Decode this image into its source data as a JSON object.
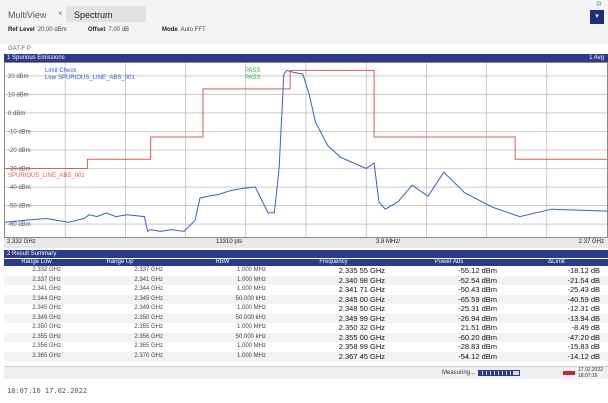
{
  "header": {
    "tab_multiview": "MultiView",
    "tab_close": "×",
    "tab_spectrum": "Spectrum",
    "ref_level_label": "Ref Level",
    "ref_level_value": "20.00 dBm",
    "offset_label": "Offset",
    "offset_value": "7.00 dB",
    "mode_label": "Mode",
    "mode_value": "Auto FFT",
    "sub_label": "GAT-F P"
  },
  "chart_panel": {
    "title": "1 Spurious Emissions",
    "badge": "1 Avg",
    "legend_line1": "Limit Check",
    "legend_line2": "Line     SPURIOUS_LINE_ABS_001",
    "legend_pass1": "PASS",
    "legend_pass2": "PASS",
    "limit_line_label": "SPURIOUS_LINE_ABS_001",
    "start_freq": "2.332 GHz",
    "points": "13310 pts",
    "step": "3.8 MHz/",
    "stop_freq": "2.37 GHz"
  },
  "colors": {
    "header_blue": "#2b3a8a",
    "trace": "#3b5bd8",
    "limit": "#e05a5a",
    "grid": "#999999"
  },
  "chart_data": {
    "type": "line",
    "y_ticks": [
      "20 dBm",
      "10 dBm",
      "0 dBm",
      "-10 dBm",
      "-20 dBm",
      "-30 dBm",
      "-40 dBm",
      "-50 dBm",
      "-60 dBm"
    ],
    "ylim": [
      -67,
      27
    ],
    "xlim": [
      2.332,
      2.37
    ],
    "grid": "on",
    "series": [
      {
        "name": "Trace 1",
        "x": [
          2.332,
          2.3333,
          2.3346,
          2.336,
          2.3365,
          2.337,
          2.3373,
          2.3378,
          2.3384,
          2.339,
          2.3397,
          2.3408,
          2.341,
          2.3412,
          2.3418,
          2.3425,
          2.3433,
          2.344,
          2.3443,
          2.3448,
          2.3455,
          2.3462,
          2.3468,
          2.3478,
          2.3486,
          2.349,
          2.3493,
          2.3496,
          2.3498,
          2.3502,
          2.3508,
          2.3512,
          2.3516,
          2.3524,
          2.3532,
          2.354,
          2.3548,
          2.3553,
          2.3556,
          2.356,
          2.3568,
          2.3577,
          2.3587,
          2.3597,
          2.361,
          2.3628,
          2.3645,
          2.3665,
          2.37
        ],
        "values": [
          -59,
          -58,
          -57,
          -59,
          -58,
          -57,
          -55,
          -56,
          -54,
          -56,
          -55,
          -56,
          -64,
          -63,
          -64,
          -63,
          -64,
          -58,
          -46,
          -45,
          -44,
          -42,
          -41,
          -40,
          -54,
          -54,
          -30,
          21,
          23,
          22,
          21,
          10,
          -5,
          -18,
          -24,
          -27,
          -30,
          -27,
          -48,
          -52,
          -48,
          -39,
          -45,
          -32,
          -43,
          -51,
          -56,
          -52,
          -53
        ]
      }
    ],
    "limit_line": {
      "name": "SPURIOUS_LINE_ABS_001",
      "x": [
        2.332,
        2.3372,
        2.3372,
        2.3412,
        2.3412,
        2.3445,
        2.3445,
        2.35,
        2.35,
        2.3553,
        2.3553,
        2.3642,
        2.3642,
        2.37
      ],
      "values": [
        -30,
        -30,
        -25,
        -25,
        -13,
        -13,
        13,
        13,
        23,
        23,
        -13,
        -13,
        -25,
        -25
      ]
    }
  },
  "result_panel": {
    "title": "2 Result Summary",
    "columns": [
      "Range Low",
      "Range Up",
      "RBW",
      "Frequency",
      "Power Abs",
      "ΔLimit"
    ],
    "rows": [
      [
        "2.332 GHz",
        "2.337 GHz",
        "1.000 MHz",
        "2.335 55 GHz",
        "-55.12 dBm",
        "-18.12 dB"
      ],
      [
        "2.337 GHz",
        "2.341 GHz",
        "1.000 MHz",
        "2.340 98 GHz",
        "-52.54 dBm",
        "-21.54 dB"
      ],
      [
        "2.341 GHz",
        "2.344 GHz",
        "1.000 MHz",
        "2.341 71 GHz",
        "-50.43 dBm",
        "-25.43 dB"
      ],
      [
        "2.344 GHz",
        "2.345 GHz",
        "50.000 kHz",
        "2.345 00 GHz",
        "-65.59 dBm",
        "-40.59 dB"
      ],
      [
        "2.345 GHz",
        "2.349 GHz",
        "1.000 MHz",
        "2.348 50 GHz",
        "-25.31 dBm",
        "-12.31 dB"
      ],
      [
        "2.349 GHz",
        "2.350 GHz",
        "50.000 kHz",
        "2.349 99 GHz",
        "-26.94 dBm",
        "-13.94 dB"
      ],
      [
        "2.350 GHz",
        "2.355 GHz",
        "1.000 MHz",
        "2.350 32 GHz",
        "21.51 dBm",
        "-8.49 dB"
      ],
      [
        "2.355 GHz",
        "2.356 GHz",
        "50.000 kHz",
        "2.355 00 GHz",
        "-60.20 dBm",
        "-47.20 dB"
      ],
      [
        "2.356 GHz",
        "2.365 GHz",
        "1.000 MHz",
        "2.358 99 GHz",
        "-28.83 dBm",
        "-15.83 dB"
      ],
      [
        "2.365 GHz",
        "2.370 GHz",
        "1.000 MHz",
        "2.367 45 GHz",
        "-54.12 dBm",
        "-14.12 dB"
      ]
    ]
  },
  "status": {
    "measuring": "Measuring...",
    "progress": 0.85,
    "date": "17.02.2022",
    "time": "18:07:16"
  },
  "footer": {
    "timestamp": "18:07:16  17.02.2022"
  }
}
